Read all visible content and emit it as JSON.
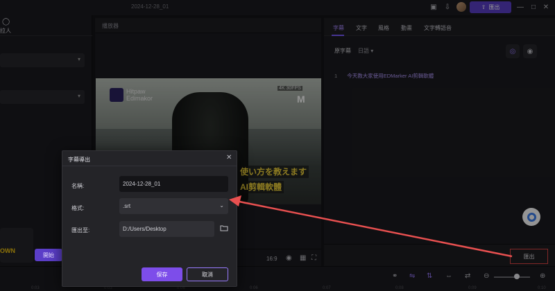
{
  "titlebar": {
    "project_title": "2024-12-28_01",
    "export_label": "匯出"
  },
  "left_panel": {
    "header_label": "拉人",
    "card_text": "OWN",
    "start_label": "開始"
  },
  "player": {
    "title": "播放器",
    "video": {
      "brand": "Hitpaw\nEdimakor",
      "badge": "4K 30FPS",
      "corner_letter": "M",
      "subtitle_line1": "使い方を教えます",
      "subtitle_line2": "AI剪輯軟體"
    },
    "aspect_ratio": "16:9"
  },
  "right_panel": {
    "tabs": [
      "字幕",
      "文字",
      "風格",
      "動畫",
      "文字轉語音"
    ],
    "active_tab": 0,
    "original_subtitle_label": "原字幕",
    "language": "日語",
    "subtitle_lines": [
      {
        "index": "1",
        "text": "今天教大家使用EDMarker AI剪輯軟體"
      }
    ],
    "export_label": "匯出"
  },
  "dialog": {
    "title": "字幕導出",
    "name_label": "名稱:",
    "name_value": "2024-12-28_01",
    "format_label": "格式:",
    "format_value": ".srt",
    "export_to_label": "匯出至:",
    "export_path": "D:/Users/Desktop",
    "save_label": "保存",
    "cancel_label": "取消"
  },
  "timeline": {
    "ruler": [
      "0:03",
      "0:03",
      "0:06",
      "0:06",
      "0:07",
      "0:08",
      "0:09",
      "0:10"
    ]
  },
  "colors": {
    "accent": "#7d4dea",
    "highlight": "#e04545",
    "arrow": "#e85050"
  }
}
